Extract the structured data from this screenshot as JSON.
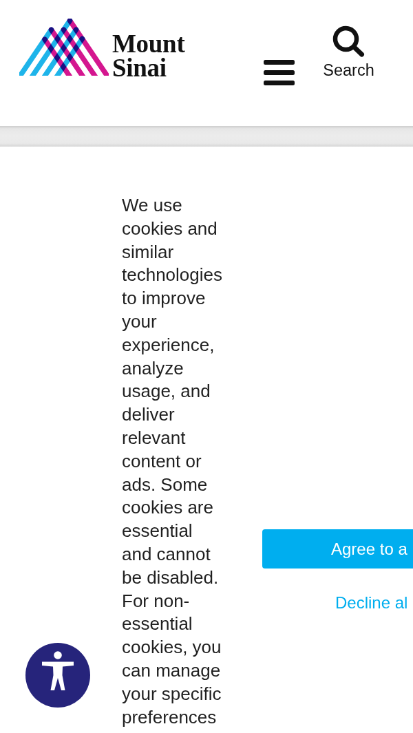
{
  "header": {
    "logo_text": "Mount Sinai",
    "search_label": "Search"
  },
  "cookie_banner": {
    "message": "We use cookies and similar technologies to improve your experience, analyze usage, and deliver relevant content or ads. Some cookies are essential and cannot be disabled. For non-essential cookies, you can manage your specific preferences",
    "buttons": [
      {
        "kind": "primary",
        "label": "Agree to a"
      },
      {
        "kind": "link",
        "label": "Decline al"
      }
    ]
  }
}
